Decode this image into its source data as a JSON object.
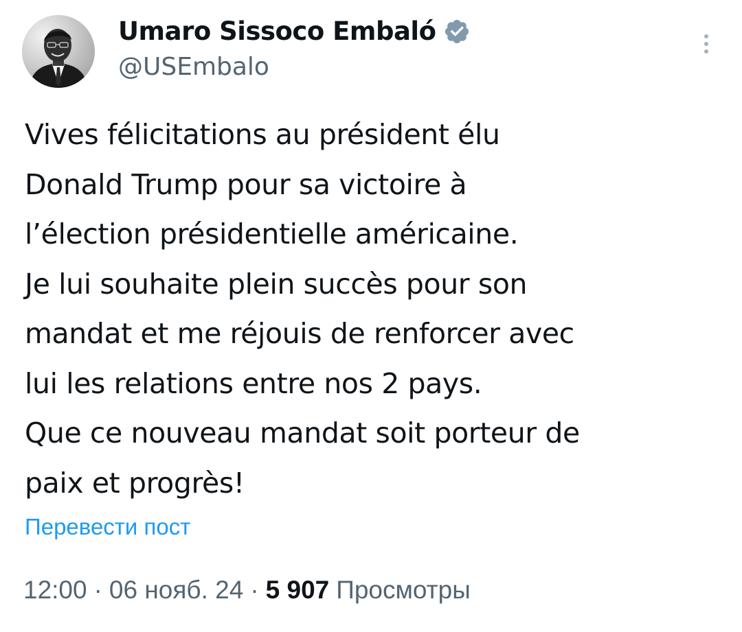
{
  "author": {
    "name": "Umaro Sissoco Embaló",
    "handle": "@USEmbalo",
    "verified": true,
    "verified_color": "#829aab",
    "avatar_icon": "profile-photo"
  },
  "tweet": {
    "lines": [
      "Vives félicitations au président élu",
      "Donald Trump pour sa victoire à",
      "l’élection présidentielle américaine.",
      "Je lui souhaite plein succès pour son",
      "mandat et me réjouis de renforcer avec",
      "lui les relations entre nos 2 pays.",
      "Que ce nouveau mandat soit porteur de",
      "paix et progrès!"
    ],
    "translate_label": "Перевести пост"
  },
  "meta": {
    "time": "12:00",
    "separator": "·",
    "date": "06 нояб. 24",
    "views_count": "5 907",
    "views_label": "Просмотры"
  },
  "colors": {
    "link": "#1d9bf0",
    "secondary_text": "#536471",
    "primary_text": "#0f1419"
  }
}
